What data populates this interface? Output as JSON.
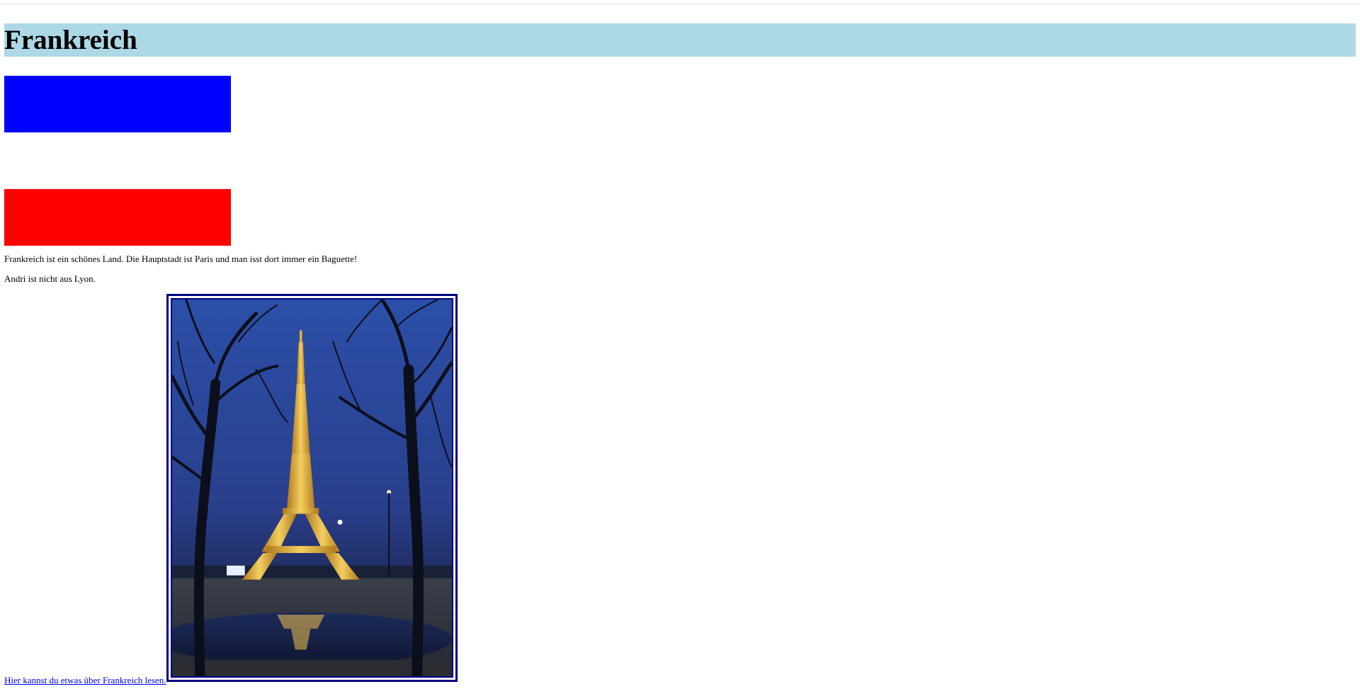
{
  "page": {
    "title": "Frankreich",
    "title_background": "#add8e6"
  },
  "flag": {
    "top_color": "#0000ff",
    "bottom_color": "#ff0000"
  },
  "content": {
    "paragraph_1": "Frankreich ist ein schönes Land. Die Hauptstadt ist Paris und man isst dort immer ein Baguette!",
    "paragraph_2": "Andri ist nicht aus Lyon."
  },
  "link": {
    "text": "Hier kannst du etwas über Frankreich lesen.",
    "color": "#0000ee"
  },
  "image": {
    "subject": "eiffel-tower-night-photo",
    "border_color": "#000080"
  }
}
